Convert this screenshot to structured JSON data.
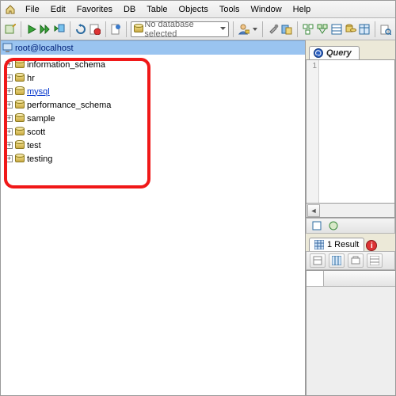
{
  "menu": [
    "File",
    "Edit",
    "Favorites",
    "DB",
    "Table",
    "Objects",
    "Tools",
    "Window",
    "Help"
  ],
  "db_selector": {
    "placeholder": "No database selected"
  },
  "connection": {
    "label": "root@localhost"
  },
  "databases": [
    {
      "name": "information_schema",
      "highlight": false
    },
    {
      "name": "hr",
      "highlight": false
    },
    {
      "name": "mysql",
      "highlight": true
    },
    {
      "name": "performance_schema",
      "highlight": false
    },
    {
      "name": "sample",
      "highlight": false
    },
    {
      "name": "scott",
      "highlight": false
    },
    {
      "name": "test",
      "highlight": false
    },
    {
      "name": "testing",
      "highlight": false
    }
  ],
  "query_tab": {
    "label": "Query"
  },
  "editor": {
    "gutter_start": "1"
  },
  "result_tab": {
    "label": "1 Result"
  },
  "icons": {
    "home": "home-icon",
    "play": "play-icon",
    "refresh": "refresh-icon",
    "user": "user-icon",
    "wrench": "wrench-icon",
    "chevron": "chevron-down-icon"
  },
  "colors": {
    "highlight_border": "#f01818",
    "conn_bg": "#9ac4f0"
  }
}
